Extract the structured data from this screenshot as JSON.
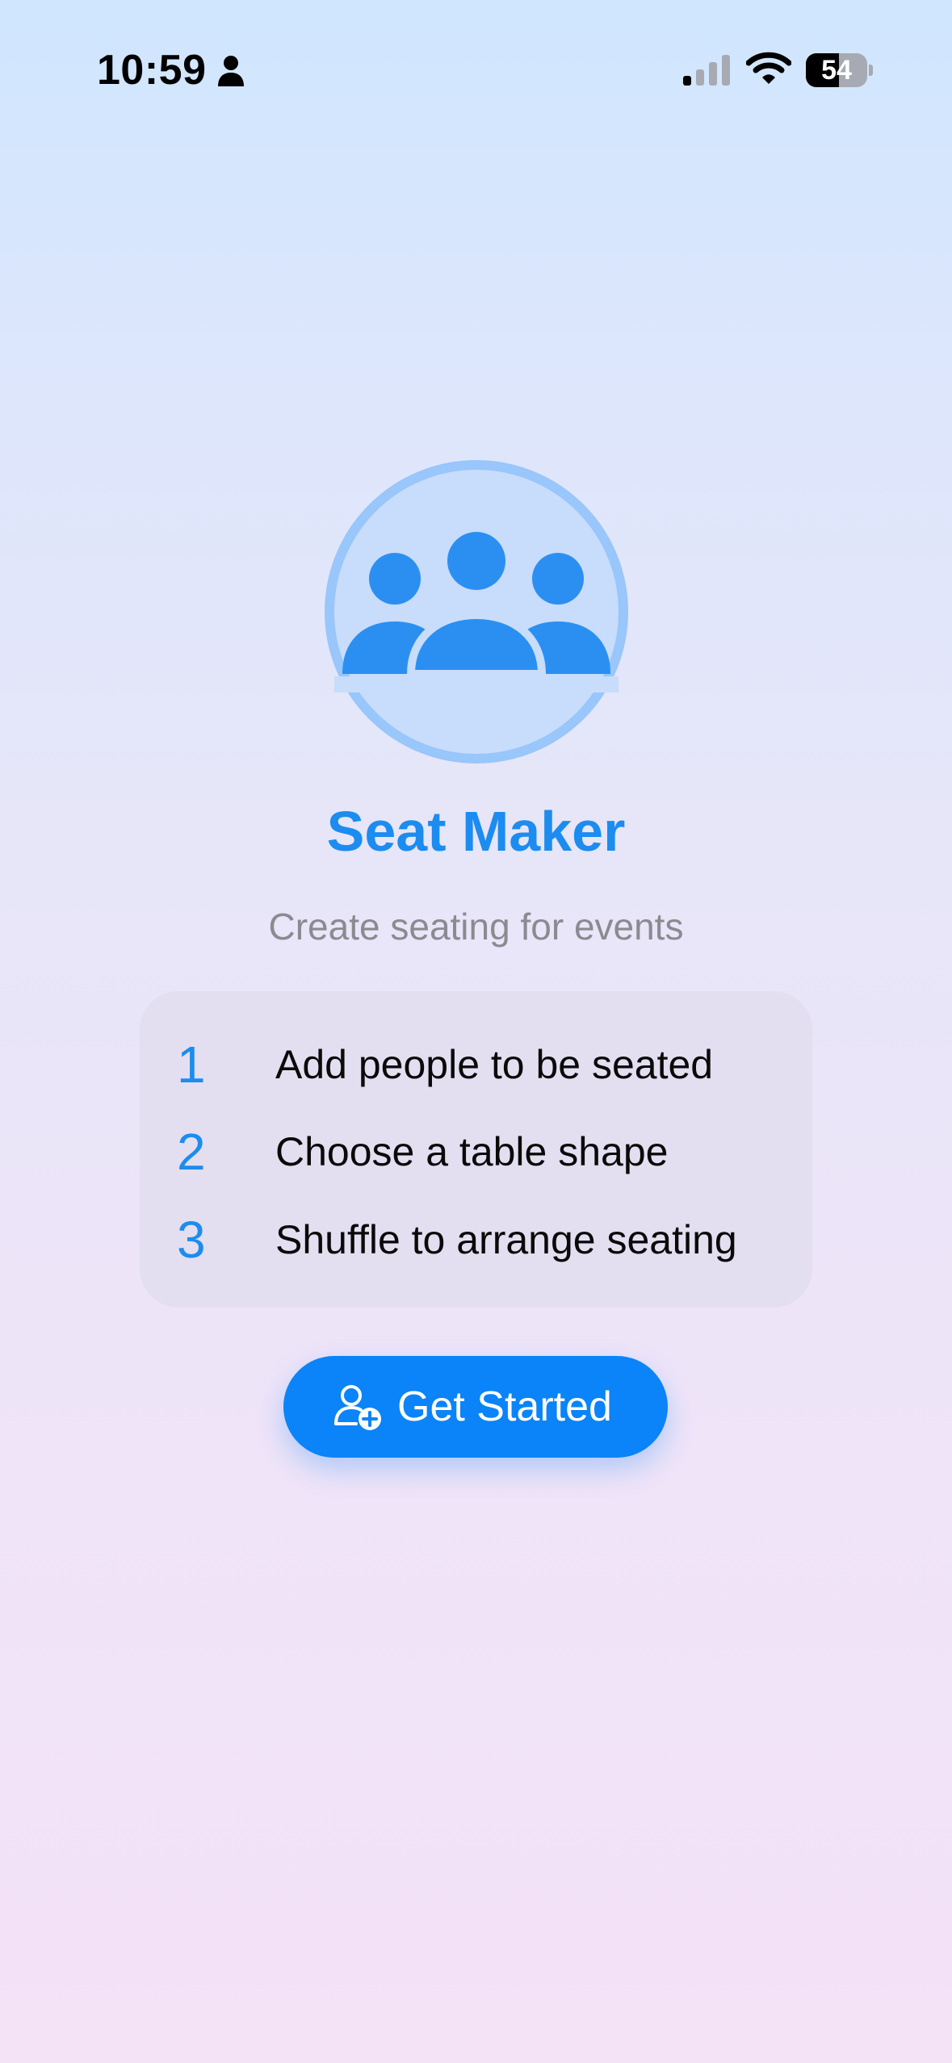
{
  "status_bar": {
    "time": "10:59",
    "battery_percent": 54,
    "battery_label": "54",
    "icons": [
      "person-icon",
      "cellular-signal-icon",
      "wifi-icon",
      "battery-icon"
    ]
  },
  "hero": {
    "logo_icon": "group-people-icon",
    "title": "Seat Maker",
    "subtitle": "Create seating for events"
  },
  "steps": [
    {
      "number": "1",
      "label": "Add people to be seated"
    },
    {
      "number": "2",
      "label": "Choose a table shape"
    },
    {
      "number": "3",
      "label": "Shuffle to arrange seating"
    }
  ],
  "cta": {
    "icon": "person-add-icon",
    "label": "Get Started"
  },
  "colors": {
    "accent": "#0a84f8",
    "title": "#1c8cf0",
    "subtitle": "#8c8a91",
    "card": "#e3dff0"
  }
}
